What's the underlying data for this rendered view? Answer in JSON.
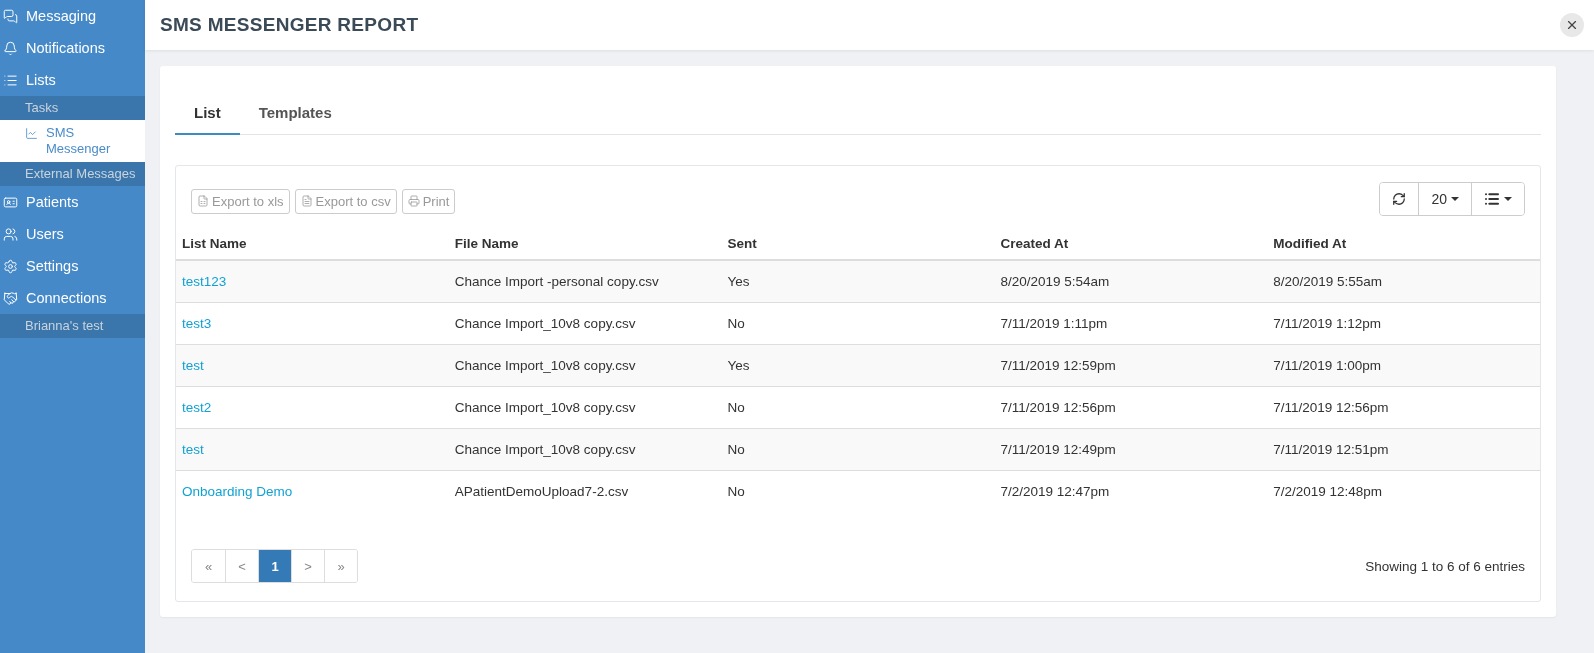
{
  "sidebar": {
    "items": [
      {
        "label": "Messaging"
      },
      {
        "label": "Notifications"
      },
      {
        "label": "Lists",
        "children": [
          {
            "label": "Tasks",
            "selected": false
          },
          {
            "label": "SMS Messenger",
            "selected": true
          },
          {
            "label": "External Messages",
            "selected": false
          }
        ]
      },
      {
        "label": "Patients"
      },
      {
        "label": "Users"
      },
      {
        "label": "Settings"
      },
      {
        "label": "Connections",
        "children": [
          {
            "label": "Brianna's test",
            "selected": false
          }
        ]
      }
    ]
  },
  "header": {
    "title": "SMS MESSENGER REPORT"
  },
  "tabs": [
    {
      "label": "List",
      "selected": true
    },
    {
      "label": "Templates",
      "selected": false
    }
  ],
  "toolbar": {
    "exports": [
      "Export to xls",
      "Export to csv",
      "Print"
    ],
    "page_size": "20"
  },
  "table": {
    "columns": [
      "List Name",
      "File Name",
      "Sent",
      "Created At",
      "Modified At"
    ],
    "rows": [
      [
        "test123",
        "Chance Import -personal copy.csv",
        "Yes",
        "8/20/2019 5:54am",
        "8/20/2019 5:55am"
      ],
      [
        "test3",
        "Chance Import_10v8 copy.csv",
        "No",
        "7/11/2019 1:11pm",
        "7/11/2019 1:12pm"
      ],
      [
        "test",
        "Chance Import_10v8 copy.csv",
        "Yes",
        "7/11/2019 12:59pm",
        "7/11/2019 1:00pm"
      ],
      [
        "test2",
        "Chance Import_10v8 copy.csv",
        "No",
        "7/11/2019 12:56pm",
        "7/11/2019 12:56pm"
      ],
      [
        "test",
        "Chance Import_10v8 copy.csv",
        "No",
        "7/11/2019 12:49pm",
        "7/11/2019 12:51pm"
      ],
      [
        "Onboarding Demo",
        "APatientDemoUpload7-2.csv",
        "No",
        "7/2/2019 12:47pm",
        "7/2/2019 12:48pm"
      ]
    ]
  },
  "pagination": {
    "pages": [
      {
        "label": "«",
        "selected": false
      },
      {
        "label": "<",
        "selected": false
      },
      {
        "label": "1",
        "selected": true
      },
      {
        "label": ">",
        "selected": false
      },
      {
        "label": "»",
        "selected": false
      }
    ],
    "summary": "Showing 1 to 6 of 6 entries"
  }
}
